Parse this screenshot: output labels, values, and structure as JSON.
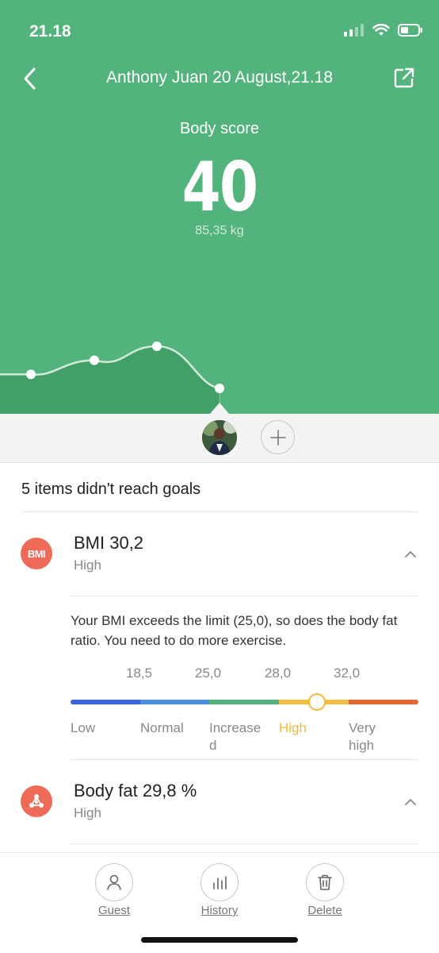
{
  "status_bar": {
    "time": "21.18"
  },
  "header": {
    "title": "Anthony Juan 20 August,21.18"
  },
  "score": {
    "label": "Body score",
    "value": "40",
    "weight": "85,35 kg"
  },
  "trend_chart": {
    "type": "line",
    "values": [
      2,
      3,
      4,
      1
    ]
  },
  "summary": {
    "text": "5 items didn't reach goals"
  },
  "bmi": {
    "icon_text": "BMI",
    "name": "BMI 30,2",
    "status": "High",
    "description": "Your BMI exceeds the limit (25,0), so does the body fat ratio. You need to do more exercise.",
    "ticks": [
      "18,5",
      "25,0",
      "28,0",
      "32,0"
    ],
    "levels": [
      {
        "label": "Low",
        "color": "#3a63e0"
      },
      {
        "label": "Normal",
        "color": "#4a8fe6"
      },
      {
        "label": "Increase\nd",
        "color": "#52b47c"
      },
      {
        "label": "High",
        "color": "#f4be3c"
      },
      {
        "label": "Very\nhigh",
        "color": "#ea6630"
      }
    ],
    "active_level": "High",
    "active_color": "#f1b93c"
  },
  "body_fat": {
    "name": "Body fat 29,8 %",
    "status": "High"
  },
  "bottom_nav": {
    "guest": "Guest",
    "history": "History",
    "delete": "Delete"
  },
  "colors": {
    "brand_green": "#52b47c",
    "alert_red": "#ef6a57"
  }
}
